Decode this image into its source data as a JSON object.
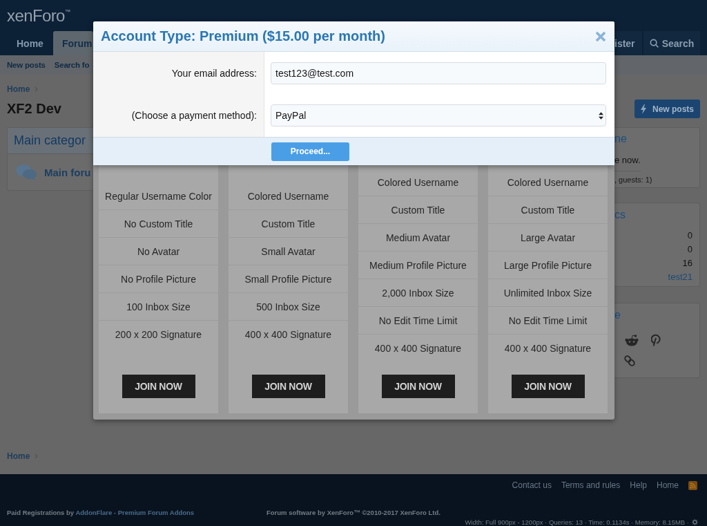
{
  "header": {
    "logo": "xenForo$^{™}$",
    "tabs": [
      {
        "label": "Home",
        "selected": false
      },
      {
        "label": "Forum",
        "selected": true
      }
    ],
    "right_tabs": [
      {
        "label": "ister",
        "kind": "text"
      },
      {
        "label": "Search",
        "kind": "search"
      }
    ]
  },
  "sub_nav": {
    "links": [
      "New posts",
      "Search fo"
    ]
  },
  "breadcrumb": {
    "items": [
      "Home"
    ]
  },
  "page_title": "XF2 Dev",
  "new_posts_button": "New posts",
  "category_block": {
    "title": "Main categor",
    "forum": "Main foru"
  },
  "modal": {
    "title": "Account Type: Premium ($15.00 per month)",
    "fields": [
      {
        "label": "Your email address:",
        "kind": "text",
        "value": "test123@test.com"
      },
      {
        "label": "(Choose a payment method):",
        "kind": "select",
        "value": "PayPal"
      }
    ],
    "submit": "Proceed..."
  },
  "pricing_columns": [
    {
      "features": [
        "Regular Username Color",
        "No Custom Title",
        "No Avatar",
        "No Profile Picture",
        "100 Inbox Size",
        "200 x 200 Signature"
      ],
      "button": "JOIN NOW"
    },
    {
      "features": [
        "Colored Username",
        "Custom Title",
        "Small Avatar",
        "Small Profile Picture",
        "500 Inbox Size",
        "400 x 400 Signature"
      ],
      "button": "JOIN NOW"
    },
    {
      "features": [
        "Colored Username",
        "Custom Title",
        "Medium Avatar",
        "Medium Profile Picture",
        "2,000 Inbox Size",
        "No Edit Time Limit",
        "400 x 400 Signature"
      ],
      "button": "JOIN NOW"
    },
    {
      "features": [
        "Colored Username",
        "Custom Title",
        "Large Avatar",
        "Large Profile Picture",
        "Unlimited Inbox Size",
        "No Edit Time Limit",
        "400 x 400 Signature"
      ],
      "button": "JOIN NOW"
    }
  ],
  "members_block": {
    "heading": "ne",
    "text": "e now.",
    "total": ", guests: 1)"
  },
  "stats_block": {
    "heading": "cs",
    "values": [
      {
        "text": "0",
        "kind": "number"
      },
      {
        "text": "0",
        "kind": "number"
      },
      {
        "text": "16",
        "kind": "number"
      },
      {
        "text": "test21",
        "kind": "link"
      }
    ]
  },
  "share_block": {
    "heading": "e"
  },
  "bottom_breadcrumb": {
    "items": [
      "Home"
    ]
  },
  "footer": {
    "links": [
      "Contact us",
      "Terms and rules",
      "Help",
      "Home"
    ],
    "credit": "Paid Registrations by",
    "credit_link": "AddonFlare - Premium Forum Addons",
    "copyright": "Forum software by XenForo™ ©2010-2017 XenForo Ltd.",
    "debug": "Width: Full 900px - 1200px · Queries: 13 · Time: 0.1134s · Memory: 8.15MB ·"
  }
}
